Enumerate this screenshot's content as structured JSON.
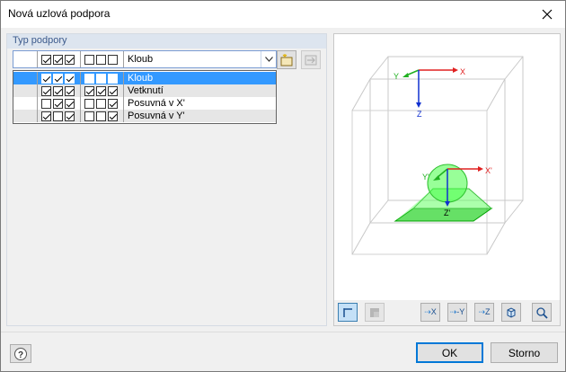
{
  "window": {
    "title": "Nová uzlová podpora"
  },
  "group": {
    "label": "Typ podpory"
  },
  "combo": {
    "selected": {
      "checks_a": [
        true,
        true,
        true
      ],
      "checks_b": [
        false,
        false,
        false
      ],
      "label": "Kloub"
    }
  },
  "dropdown": {
    "items": [
      {
        "checks_a": [
          true,
          true,
          true
        ],
        "checks_b": [
          false,
          false,
          false
        ],
        "label": "Kloub",
        "selected": true
      },
      {
        "checks_a": [
          true,
          true,
          true
        ],
        "checks_b": [
          true,
          true,
          true
        ],
        "label": "Vetknutí",
        "selected": false
      },
      {
        "checks_a": [
          false,
          true,
          true
        ],
        "checks_b": [
          false,
          false,
          true
        ],
        "label": "Posuvná v X'",
        "selected": false
      },
      {
        "checks_a": [
          true,
          false,
          true
        ],
        "checks_b": [
          false,
          false,
          true
        ],
        "label": "Posuvná v Y'",
        "selected": false
      }
    ]
  },
  "preview": {
    "global_axes": {
      "x": "X",
      "y": "Y",
      "z": "Z"
    },
    "local_axes": {
      "x": "X'",
      "y": "Y'",
      "z": "Z'"
    },
    "colors": {
      "x_axis": "#e02020",
      "y_axis": "#20b020",
      "z_axis": "#1030d0",
      "support": "#3ce63c"
    }
  },
  "view_toolbar": {
    "buttons": [
      {
        "name": "axes-toggle-icon",
        "label": ""
      },
      {
        "name": "solid-toggle-icon",
        "label": ""
      },
      {
        "name": "view-x-icon",
        "label": "X"
      },
      {
        "name": "view-y-icon",
        "label": "-Y"
      },
      {
        "name": "view-z-icon",
        "label": "Z"
      },
      {
        "name": "isometric-icon",
        "label": ""
      },
      {
        "name": "zoom-reset-icon",
        "label": ""
      }
    ]
  },
  "footer": {
    "ok_label": "OK",
    "cancel_label": "Storno"
  }
}
